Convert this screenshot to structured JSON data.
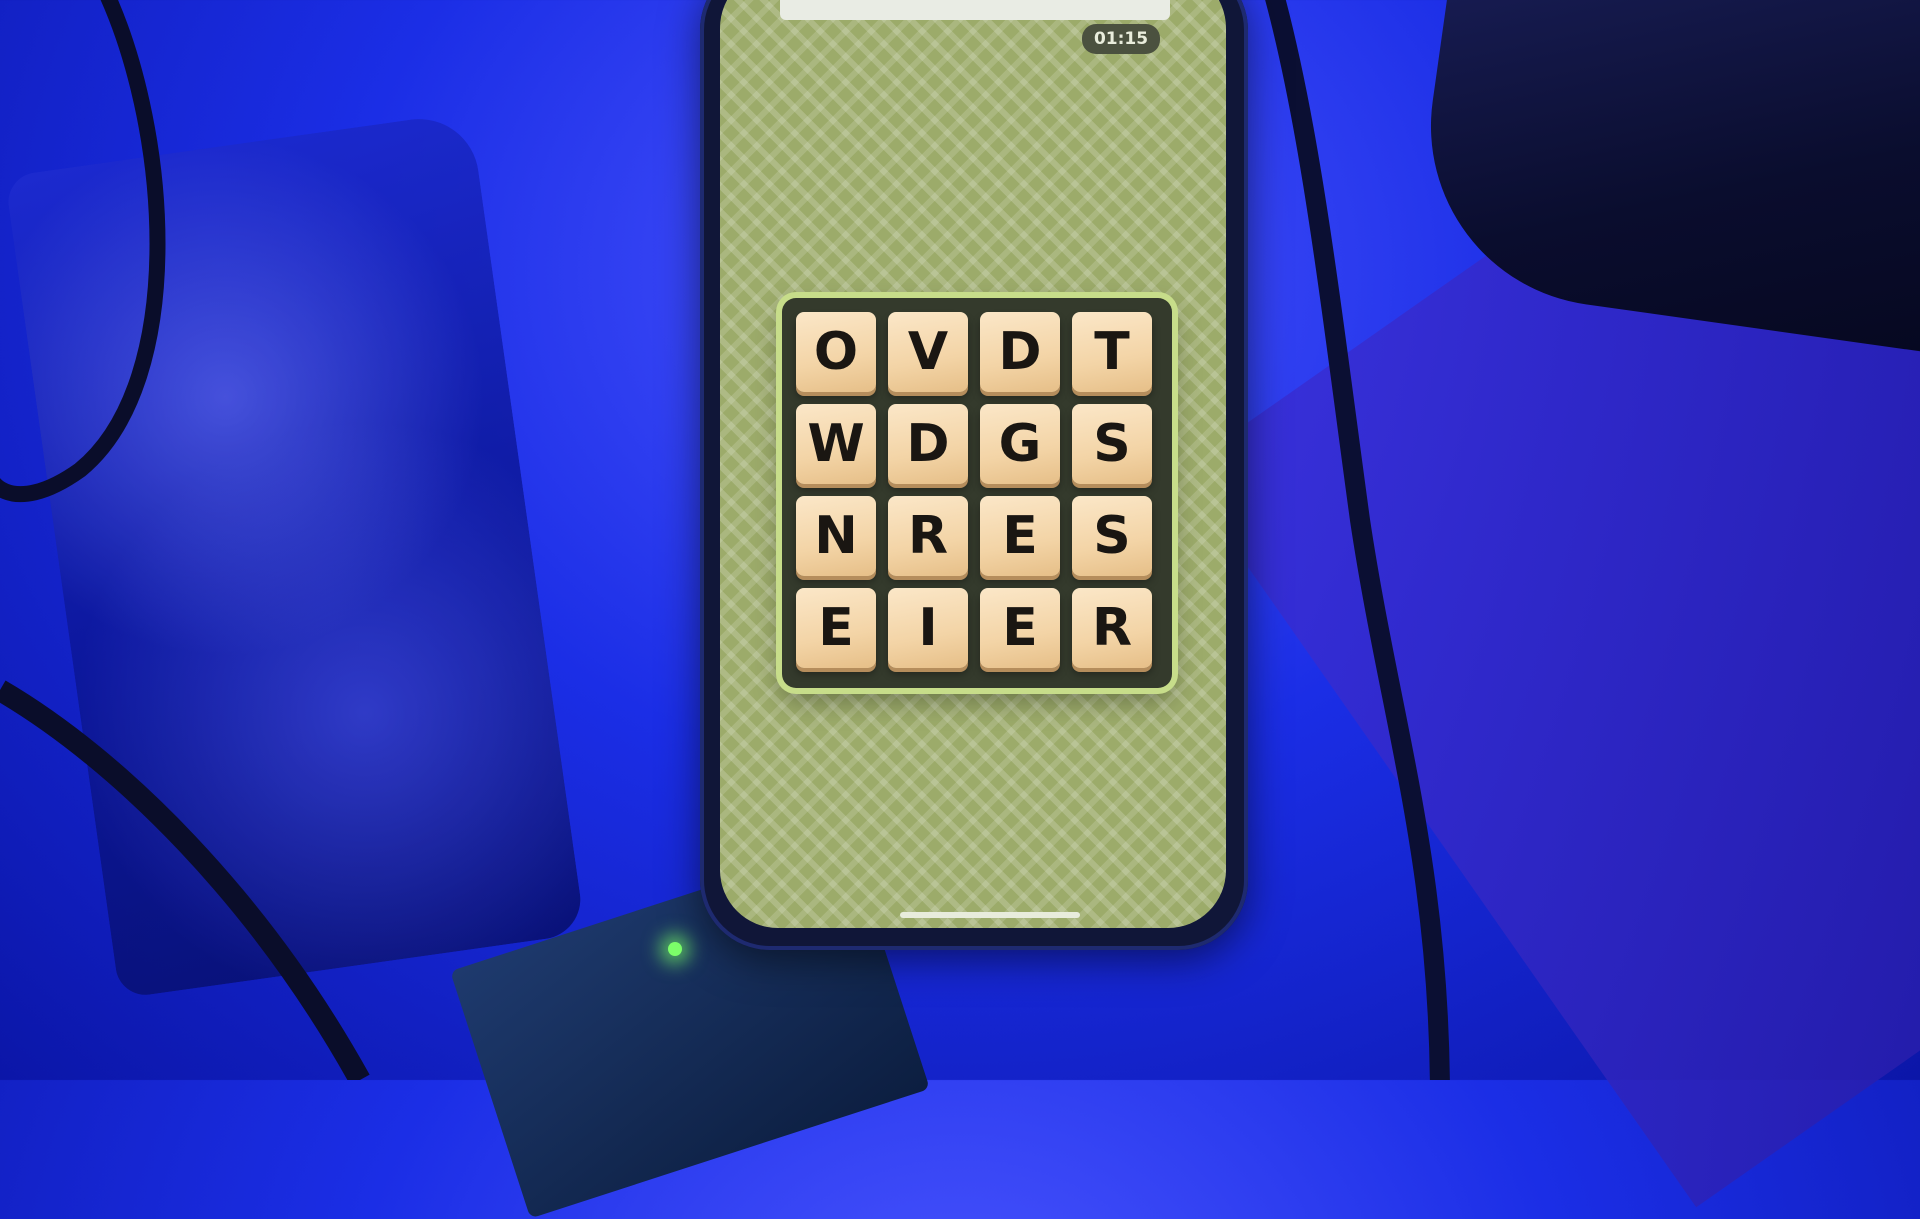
{
  "game": {
    "timer": "01:15",
    "letter_grid": [
      [
        "O",
        "V",
        "D",
        "T"
      ],
      [
        "W",
        "D",
        "G",
        "S"
      ],
      [
        "N",
        "R",
        "E",
        "S"
      ],
      [
        "E",
        "I",
        "E",
        "R"
      ]
    ]
  },
  "colors": {
    "screen_background": "#9cab6a",
    "grid_frame": "#343a2c",
    "grid_border_glow": "#c7dd8a",
    "tile_face": "#f3d4a6",
    "letter": "#1a1612",
    "ambient_light": "#1b2ee6"
  }
}
